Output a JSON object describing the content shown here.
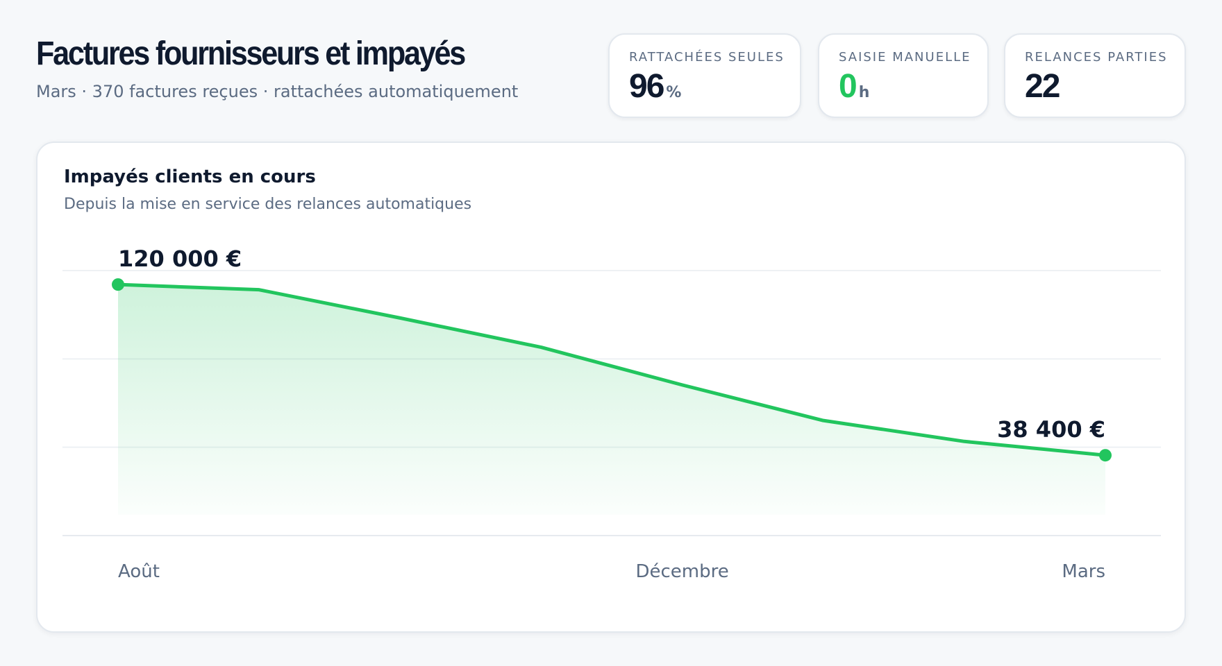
{
  "header": {
    "title": "Factures fournisseurs et impayés",
    "subtitle": "Mars · 370 factures reçues · rattachées automatiquement"
  },
  "kpis": [
    {
      "label": "RATTACHÉES SEULES",
      "value": "96",
      "unit": "%",
      "color": "#0f1a2e"
    },
    {
      "label": "SAISIE MANUELLE",
      "value": "0",
      "unit": "h",
      "color": "#22c55e"
    },
    {
      "label": "RELANCES PARTIES",
      "value": "22",
      "unit": "",
      "color": "#0f1a2e"
    }
  ],
  "card": {
    "title": "Impayés clients en cours",
    "subtitle": "Depuis la mise en service des relances automatiques"
  },
  "chart_data": {
    "type": "area",
    "title": "Impayés clients en cours",
    "subtitle": "Depuis la mise en service des relances automatiques",
    "x": [
      0,
      1,
      2,
      3,
      4,
      5,
      6,
      7
    ],
    "x_ticks": [
      {
        "x": 0,
        "label": "Août"
      },
      {
        "x": 4,
        "label": "Décembre"
      },
      {
        "x": 7,
        "label": "Mars"
      }
    ],
    "series": [
      {
        "values": [
          120000,
          117500,
          104000,
          90000,
          72000,
          55000,
          45000,
          38400
        ],
        "color": "#22c55e"
      }
    ],
    "annotations": [
      {
        "index": 0,
        "label": "120 000 €"
      },
      {
        "index": 7,
        "label": "38 400 €"
      }
    ],
    "ylim": [
      0,
      128000
    ],
    "grid": true,
    "legend": "none"
  }
}
